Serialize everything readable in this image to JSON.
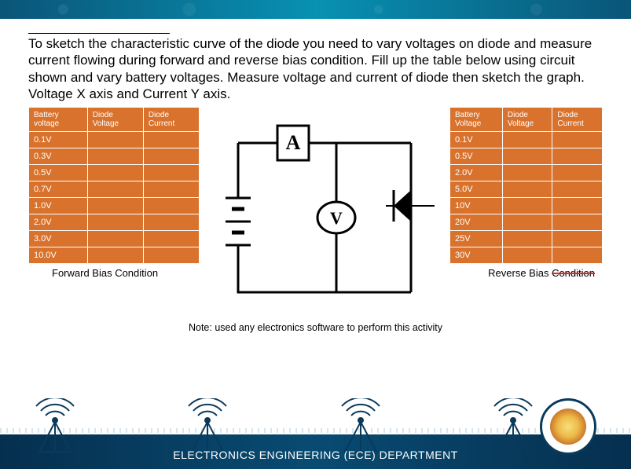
{
  "instructions": "To sketch the characteristic curve of the diode you need to vary voltages on diode and measure current flowing during forward and reverse bias condition. Fill up the table below using circuit shown and vary  battery voltages. Measure voltage and current of diode then sketch the graph. Voltage X axis and Current Y axis.",
  "left_table": {
    "headers": [
      "Battery voltage",
      "Diode Voltage",
      "Diode Current"
    ],
    "rows": [
      "0.1V",
      "0.3V",
      "0.5V",
      "0.7V",
      "1.0V",
      "2.0V",
      "3.0V",
      "10.0V"
    ],
    "caption": "Forward Bias Condition"
  },
  "right_table": {
    "headers": [
      "Battery Voltage",
      "Diode Voltage",
      "Diode Current"
    ],
    "rows": [
      "0.1V",
      "0.5V",
      "2.0V",
      "5.0V",
      "10V",
      "20V",
      "25V",
      "30V"
    ],
    "caption_prefix": "Reverse Bias ",
    "caption_strike": "Condition"
  },
  "circuit": {
    "ammeter_label": "A",
    "voltmeter_label": "V"
  },
  "note": "Note: used any electronics software to perform this activity",
  "footer": "ELECTRONICS ENGINEERING (ECE) DEPARTMENT"
}
